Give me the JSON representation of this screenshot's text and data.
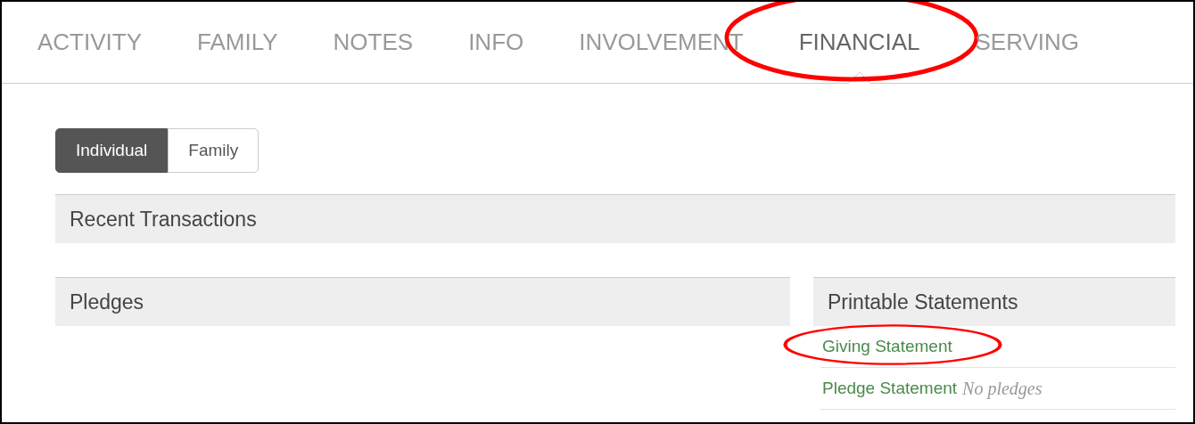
{
  "tabs": [
    {
      "label": "ACTIVITY",
      "selected": false,
      "highlighted": false
    },
    {
      "label": "FAMILY",
      "selected": false,
      "highlighted": false
    },
    {
      "label": "NOTES",
      "selected": false,
      "highlighted": false
    },
    {
      "label": "INFO",
      "selected": false,
      "highlighted": false
    },
    {
      "label": "INVOLVEMENT",
      "selected": false,
      "highlighted": false
    },
    {
      "label": "FINANCIAL",
      "selected": true,
      "highlighted": true
    },
    {
      "label": "SERVING",
      "selected": false,
      "highlighted": false
    }
  ],
  "scope_toggle": [
    {
      "label": "Individual",
      "selected": true
    },
    {
      "label": "Family",
      "selected": false
    }
  ],
  "recent_transactions": {
    "title": "Recent Transactions"
  },
  "pledges": {
    "title": "Pledges"
  },
  "printable_statements": {
    "title": "Printable Statements",
    "links": [
      {
        "label": "Giving Statement",
        "highlighted": true
      },
      {
        "label": "Pledge Statement",
        "note": "No pledges",
        "highlighted": false
      }
    ]
  }
}
